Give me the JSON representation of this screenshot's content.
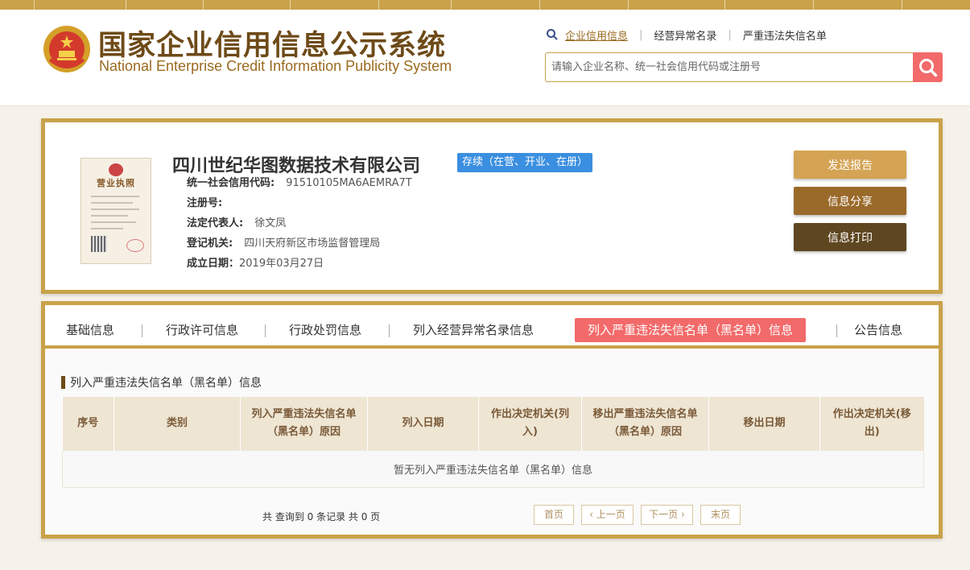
{
  "header": {
    "title_cn": "国家企业信用信息公示系统",
    "title_en": "National Enterprise Credit Information Publicity System",
    "links": [
      "企业信用信息",
      "经营异常名录",
      "严重违法失信名单"
    ],
    "search_placeholder": "请输入企业名称、统一社会信用代码或注册号"
  },
  "company": {
    "license_title": "营业执照",
    "name": "四川世纪华图数据技术有限公司",
    "status": "存续（在营、开业、在册）",
    "fields": [
      {
        "label": "统一社会信用代码:",
        "value": "91510105MA6AEMRA7T"
      },
      {
        "label": "注册号:",
        "value": ""
      },
      {
        "label": "法定代表人:",
        "value": "徐文凤"
      },
      {
        "label": "登记机关:",
        "value": "四川天府新区市场监督管理局"
      },
      {
        "label": "成立日期：",
        "value": "2019年03月27日"
      }
    ],
    "buttons": {
      "report": "发送报告",
      "share": "信息分享",
      "print": "信息打印"
    }
  },
  "tabs": [
    {
      "label": "基础信息"
    },
    {
      "label": "行政许可信息"
    },
    {
      "label": "行政处罚信息"
    },
    {
      "label": "列入经营异常名录信息"
    },
    {
      "label": "列入严重违法失信名单（黑名单）信息"
    },
    {
      "label": "公告信息"
    }
  ],
  "section": {
    "title": "列入严重违法失信名单（黑名单）信息",
    "columns": [
      "序号",
      "类别",
      "列入严重违法失信名单（黑名单）原因",
      "列入日期",
      "作出决定机关(列入)",
      "移出严重违法失信名单（黑名单）原因",
      "移出日期",
      "作出决定机关(移出)"
    ],
    "empty_text": "暂无列入严重违法失信名单（黑名单）信息"
  },
  "pager": {
    "summary": "共 查询到 0 条记录 共 0 页",
    "first": "首页",
    "prev": "上一页",
    "next": "下一页",
    "last": "末页"
  }
}
